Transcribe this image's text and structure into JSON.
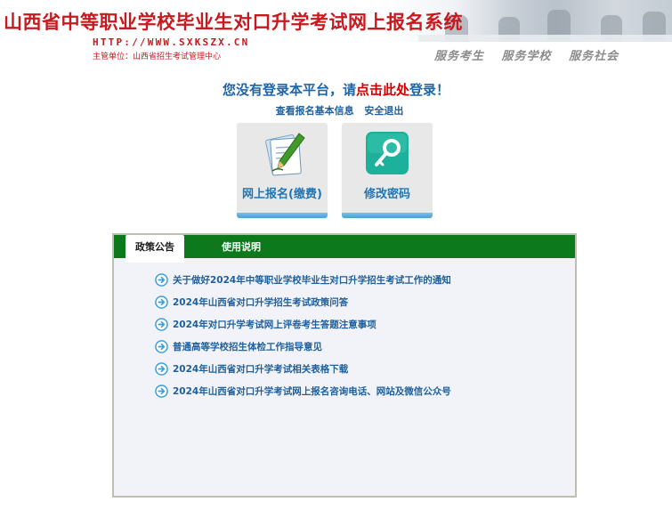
{
  "header": {
    "title": "山西省中等职业学校毕业生对口升学考试网上报名系统",
    "url": "HTTP://WWW.SXKSZX.CN",
    "organizer": "主管单位：山西省招生考试管理中心",
    "slogans": [
      "服务考生",
      "服务学校",
      "服务社会"
    ]
  },
  "prompt": {
    "before": "您没有登录本平台，请",
    "link": "点击此处",
    "after": "登录！"
  },
  "quick_links": {
    "view_info": "查看报名基本信息",
    "logout": "安全退出"
  },
  "tiles": {
    "register": {
      "label": "网上报名(缴费)",
      "icon": "pen-paper-icon"
    },
    "password": {
      "label": "修改密码",
      "icon": "key-icon"
    }
  },
  "notice_panel": {
    "tabs": [
      {
        "label": "政策公告",
        "active": true
      },
      {
        "label": "使用说明",
        "active": false
      }
    ],
    "items": [
      "关于做好2024年中等职业学校毕业生对口升学招生考试工作的通知",
      "2024年山西省对口升学招生考试政策问答",
      "2024年对口升学考试网上评卷考生答题注意事项",
      "普通高等学校招生体检工作指导意见",
      "2024年山西省对口升学考试相关表格下载",
      "2024年山西省对口升学考试网上报名咨询电话、网站及微信公众号"
    ]
  },
  "colors": {
    "brand_red": "#c8191f",
    "link_blue": "#1f66a8",
    "highlight_red": "#d20000",
    "tab_green": "#0c7a1c",
    "panel_bg": "#f1f3f9",
    "key_tile_teal": "#1db09b"
  }
}
